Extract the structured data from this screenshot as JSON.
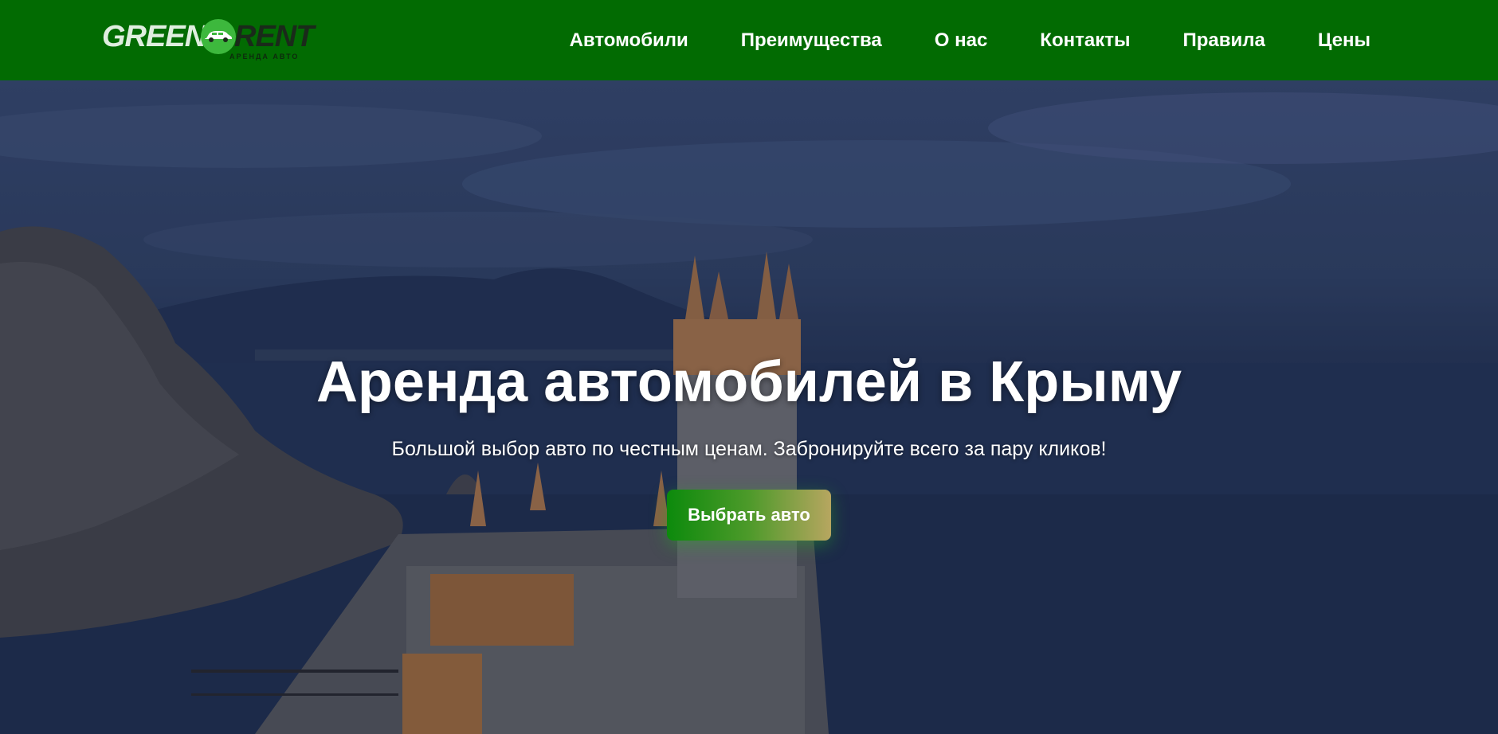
{
  "header": {
    "logo": {
      "word_left": "GREEN",
      "word_right": "RENT",
      "tagline": "АРЕНДА АВТО"
    },
    "nav": [
      {
        "label": "Автомобили"
      },
      {
        "label": "Преимущества"
      },
      {
        "label": "О нас"
      },
      {
        "label": "Контакты"
      },
      {
        "label": "Правила"
      },
      {
        "label": "Цены"
      }
    ]
  },
  "hero": {
    "title": "Аренда автомобилей в Крыму",
    "subtitle": "Большой выбор авто по честным ценам. Забронируйте всего за пару кликов!",
    "cta_label": "Выбрать авто"
  },
  "colors": {
    "header_bg": "#026b02",
    "logo_circle": "#3db83d",
    "text": "#ffffff",
    "cta_gradient_start": "#0c8a0c",
    "cta_gradient_end": "#b7a660"
  },
  "icons": {
    "logo_mark": "car-icon"
  }
}
